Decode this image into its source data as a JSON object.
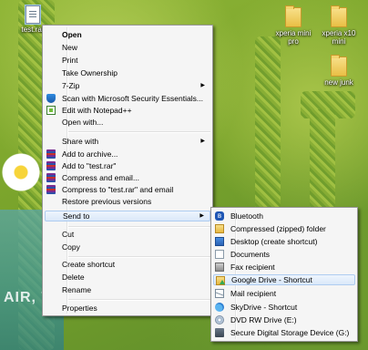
{
  "desktop": {
    "wallpaper_text": "AIR, T",
    "icons": [
      {
        "label": "test.rar"
      },
      {
        "label": "xperia mini pro"
      },
      {
        "label": "xperia x10 mini"
      },
      {
        "label": "new junk"
      }
    ]
  },
  "context_menu": {
    "items": [
      {
        "label": "Open"
      },
      {
        "label": "New"
      },
      {
        "label": "Print"
      },
      {
        "label": "Take Ownership"
      },
      {
        "label": "7-Zip",
        "arrow": "▶"
      },
      {
        "label": "Scan with Microsoft Security Essentials..."
      },
      {
        "label": "Edit with Notepad++"
      },
      {
        "label": "Open with..."
      },
      {
        "label": "Share with",
        "arrow": "▶"
      },
      {
        "label": "Add to archive..."
      },
      {
        "label": "Add to \"test.rar\""
      },
      {
        "label": "Compress and email..."
      },
      {
        "label": "Compress to \"test.rar\" and email"
      },
      {
        "label": "Restore previous versions"
      },
      {
        "label": "Send to",
        "arrow": "▶"
      },
      {
        "label": "Cut"
      },
      {
        "label": "Copy"
      },
      {
        "label": "Create shortcut"
      },
      {
        "label": "Delete"
      },
      {
        "label": "Rename"
      },
      {
        "label": "Properties"
      }
    ]
  },
  "send_to_menu": {
    "items": [
      {
        "label": "Bluetooth",
        "icon": "ʙ"
      },
      {
        "label": "Compressed (zipped) folder"
      },
      {
        "label": "Desktop (create shortcut)"
      },
      {
        "label": "Documents"
      },
      {
        "label": "Fax recipient"
      },
      {
        "label": "Google Drive - Shortcut"
      },
      {
        "label": "Mail recipient"
      },
      {
        "label": "SkyDrive - Shortcut"
      },
      {
        "label": "DVD RW Drive (E:)"
      },
      {
        "label": "Secure Digital Storage Device (G:)"
      }
    ]
  }
}
